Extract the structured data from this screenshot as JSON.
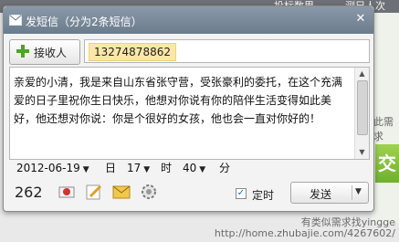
{
  "background": {
    "top_left_text": "投标数里",
    "top_right_text": "测兄人次",
    "side_text": "此需求",
    "green_text": "交",
    "bottom_line1": "有类似需求找yingge",
    "bottom_line2": "http://home.zhubajie.com/4267602/"
  },
  "dialog": {
    "title": "发短信（分为2条短信）",
    "add_recipient_label": "接收人",
    "recipient": "13274878862",
    "message": "亲爱的小清，我是来自山东省张守营，受张豪利的委托，在这个充满爱的日子里祝你生日快乐，他想对你说有你的陪伴生活变得如此美好，他还想对你说：你是个很好的女孩，他也会一直对你好的！",
    "date_value": "2012-06-19",
    "day_label": "日",
    "hour_value": "17",
    "hour_label": "时",
    "minute_value": "40",
    "minute_label": "分",
    "char_count": "262",
    "schedule_label": "定时",
    "send_label": "发送"
  },
  "colors": {
    "title_bar": "#7a8a9a",
    "chip_bg": "#fce7a7",
    "accent_green": "#6fb12b"
  },
  "icons": [
    "envelope-icon",
    "close-icon",
    "plus-icon",
    "stamp-icon",
    "edit-icon",
    "mail-icon",
    "settings-icon",
    "chevron-down-icon"
  ]
}
